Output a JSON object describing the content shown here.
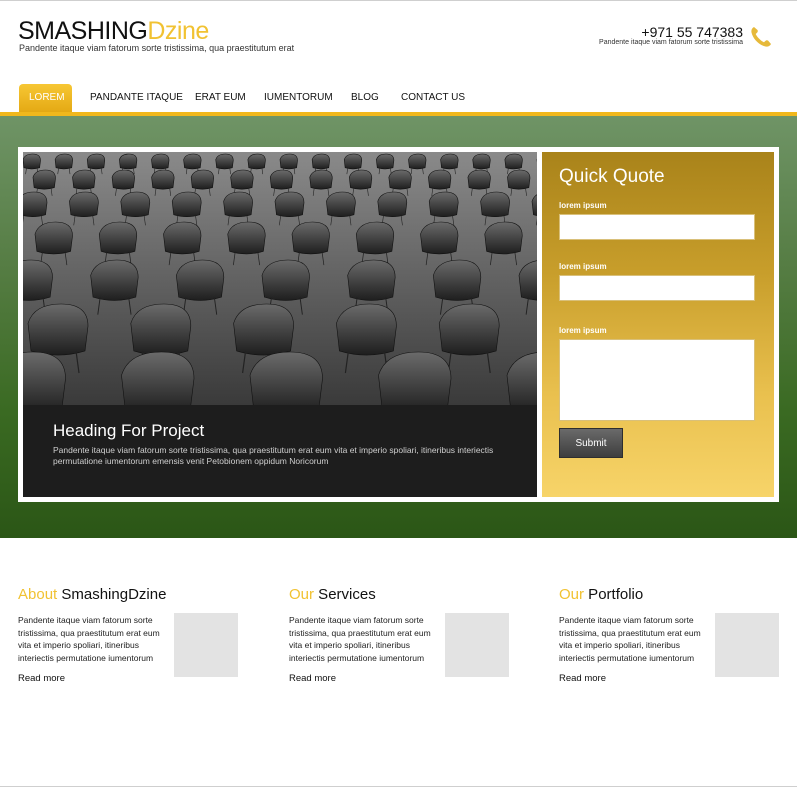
{
  "header": {
    "logo_part1": "SMASHING",
    "logo_part2": "Dzine",
    "tagline": "Pandente itaque viam fatorum sorte tristissima, qua praestitutum erat",
    "phone": "+971 55 747383",
    "phone_subtext": "Pandente itaque viam fatorum sorte tristissima",
    "phone_icon": "phone-icon"
  },
  "nav": {
    "items": [
      {
        "label": "LOREM",
        "active": true
      },
      {
        "label": "PANDANTE ITAQUE",
        "active": false
      },
      {
        "label": "ERAT EUM",
        "active": false
      },
      {
        "label": "IUMENTORUM",
        "active": false
      },
      {
        "label": "BLOG",
        "active": false
      },
      {
        "label": "CONTACT US",
        "active": false
      }
    ]
  },
  "hero": {
    "image": "auditorium-chairs-photo",
    "caption_title": "Heading For Project",
    "caption_text": "Pandente itaque viam fatorum sorte tristissima, qua praestitutum erat eum vita et imperio spoliari, itineribus interiectis permutatione iumentorum emensis venit Petobionem oppidum Noricorum"
  },
  "quote": {
    "title": "Quick Quote",
    "field1_label": "lorem ipsum",
    "field2_label": "lorem ipsum",
    "field3_label": "lorem ipsum",
    "submit_label": "Submit"
  },
  "columns": [
    {
      "accent": "About",
      "title": " SmashingDzine",
      "text": "Pandente itaque viam fatorum sorte tristissima, qua praestitutum erat eum vita et imperio spoliari, itineribus interiectis permutatione iumentorum",
      "more": "Read more"
    },
    {
      "accent": "Our",
      "title": " Services",
      "text": "Pandente itaque viam fatorum sorte tristissima, qua praestitutum erat eum vita et imperio spoliari, itineribus interiectis permutatione iumentorum",
      "more": "Read more"
    },
    {
      "accent": "Our",
      "title": " Portfolio",
      "text": "Pandente itaque viam fatorum sorte tristissima, qua praestitutum erat eum vita et imperio spoliari, itineribus interiectis permutatione iumentorum",
      "more": "Read more"
    }
  ],
  "colors": {
    "accent": "#f1c232",
    "nav_bar": "#f1b81c",
    "hero_green": "#3a6a22",
    "quote_gold": "#c89e2b",
    "caption_bg": "#1d1d1d"
  }
}
